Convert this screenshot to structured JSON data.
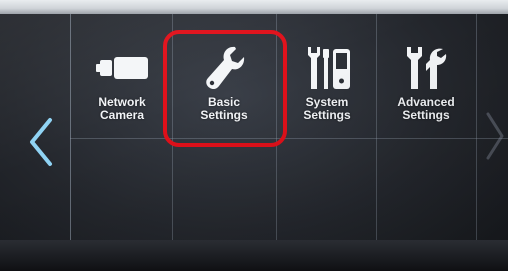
{
  "menu": {
    "tiles": [
      {
        "label": "Network\nCamera",
        "icon": "camera-icon"
      },
      {
        "label": "Basic\nSettings",
        "icon": "wrench-icon"
      },
      {
        "label": "System\nSettings",
        "icon": "system-settings-icon"
      },
      {
        "label": "Advanced\nSettings",
        "icon": "advanced-settings-icon"
      }
    ],
    "selected": "Basic Settings"
  },
  "nav": {
    "prev_icon": "chevron-left-icon",
    "next_icon": "chevron-right-icon"
  },
  "colors": {
    "highlight": "#e0101a",
    "nav_arrow": "#8fd3f4",
    "label": "#f2f4f7"
  }
}
